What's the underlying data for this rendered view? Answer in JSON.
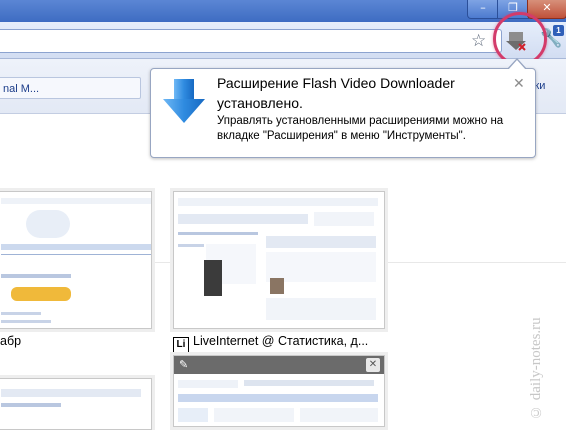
{
  "window": {
    "minimize_glyph": "–",
    "restore_glyph": "❐",
    "close_glyph": "✕"
  },
  "toolbar": {
    "star_glyph": "☆",
    "wrench_glyph": "🔧",
    "badge": "1"
  },
  "bookmarks": {
    "item_left": "nal M...",
    "item_right": "лки"
  },
  "popup": {
    "title": "Расширение Flash Video Downloader установлено.",
    "text": "Управлять установленными расширениями можно на вкладке \"Расширения\" в меню \"Инструменты\".",
    "close_glyph": "✕"
  },
  "thumbnails": [
    {
      "title": "абр"
    },
    {
      "title": "LiveInternet @ Статистика, д...",
      "logo": "Li"
    }
  ],
  "thumb4": {
    "pin_glyph": "✎",
    "close_glyph": "✕"
  },
  "watermark": "© daily-notes.ru",
  "colors": {
    "titlebar": "#4a77c9",
    "highlight": "#d33b6a",
    "popup_arrow_blue": "#2f8be0"
  }
}
